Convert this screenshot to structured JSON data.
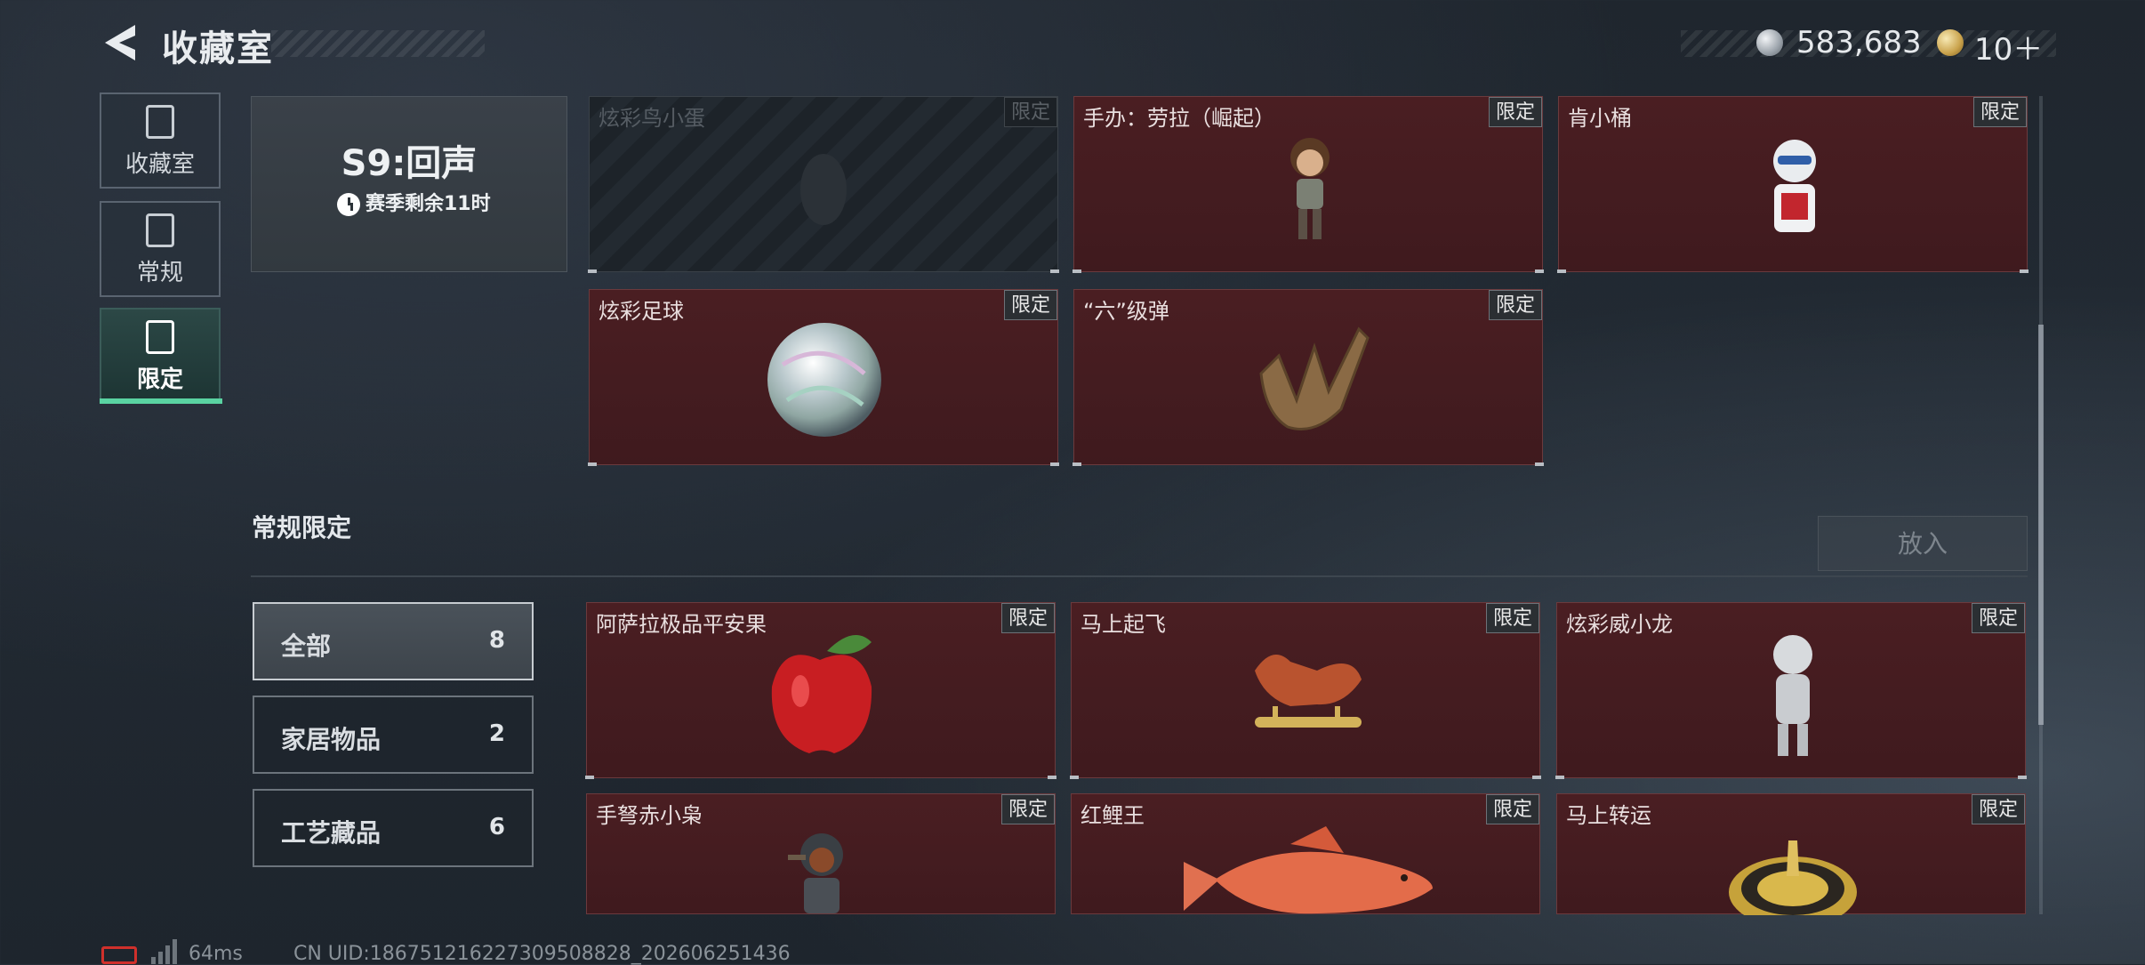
{
  "header": {
    "title": "收藏室",
    "currency_1": "583,683",
    "currency_2": "10＋"
  },
  "nav": {
    "items": [
      {
        "label": "收藏室",
        "icon": "collection-room-icon"
      },
      {
        "label": "常规",
        "icon": "regular-icon"
      },
      {
        "label": "限定",
        "icon": "limited-icon"
      }
    ]
  },
  "season": {
    "title": "S9:回声",
    "remaining": "赛季剩余11时"
  },
  "season_cards": [
    {
      "name": "炫彩鸟小蛋",
      "tag": "限定"
    },
    {
      "name": "手办：劳拉（崛起）",
      "tag": "限定"
    },
    {
      "name": "肯小桶",
      "tag": "限定"
    },
    {
      "name": "炫彩足球",
      "tag": "限定"
    },
    {
      "name": "“六”级弹",
      "tag": "限定"
    }
  ],
  "section": {
    "title": "常规限定",
    "put_button": "放入"
  },
  "filters": [
    {
      "label": "全部",
      "count": "8"
    },
    {
      "label": "家居物品",
      "count": "2"
    },
    {
      "label": "工艺藏品",
      "count": "6"
    }
  ],
  "items": [
    {
      "name": "阿萨拉极品平安果",
      "tag": "限定"
    },
    {
      "name": "马上起飞",
      "tag": "限定"
    },
    {
      "name": "炫彩威小龙",
      "tag": "限定"
    },
    {
      "name": "手弩赤小枭",
      "tag": "限定"
    },
    {
      "name": "红鲤王",
      "tag": "限定"
    },
    {
      "name": "马上转运",
      "tag": "限定"
    }
  ],
  "footer": {
    "ping": "64ms",
    "uid": "CN UID:18675121622730950882​8_202606251436"
  },
  "colors": {
    "accent": "#5ad3a2",
    "card_bg": "#4a1e22",
    "battery_low": "#d0302b"
  }
}
